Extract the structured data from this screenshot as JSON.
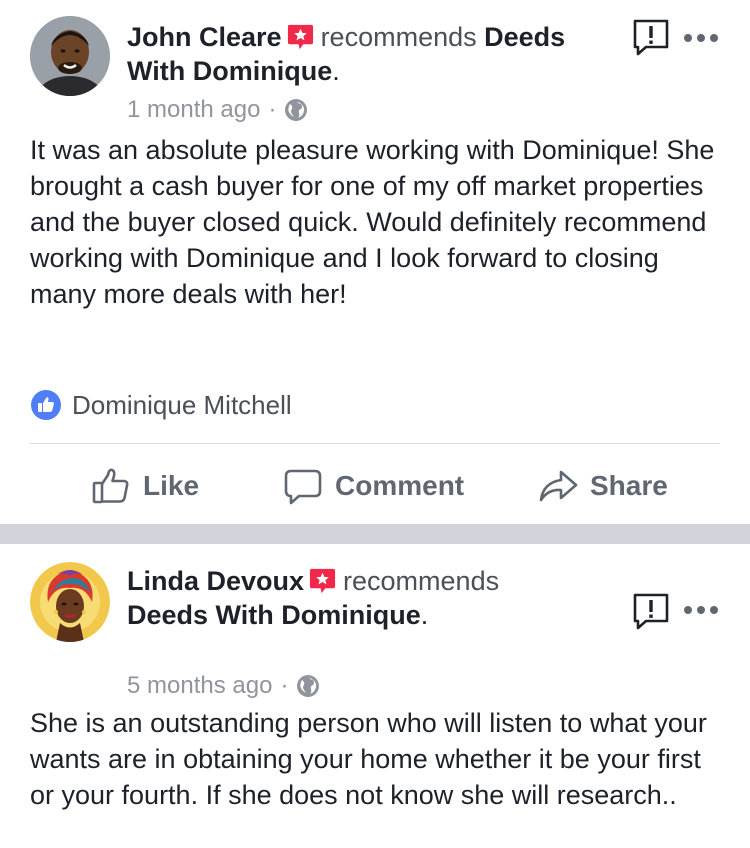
{
  "posts": [
    {
      "author": "John Cleare",
      "verb": "recommends",
      "page": "Deeds With Dominique",
      "page_line1": "Deeds",
      "page_line2": "With Dominique",
      "period": ".",
      "time": "1 month ago",
      "separator": "·",
      "body": "It was an absolute pleasure working with Dominique! She brought a cash buyer for one of my off market properties and the buyer closed quick. Would definitely recommend working with Dominique and I look forward to closing many more deals with her!",
      "liked_by": "Dominique Mitchell",
      "actions": {
        "like": "Like",
        "comment": "Comment",
        "share": "Share"
      },
      "avatar_icon": "person-avatar-man"
    },
    {
      "author": "Linda Devoux",
      "verb": "recommends",
      "page": "Deeds With Dominique",
      "period": ".",
      "time": "5 months ago",
      "separator": "·",
      "body": "She is an outstanding person who will listen to what your wants are in obtaining your home whether it be your first or your fourth. If she does not know she will research..",
      "avatar_icon": "illustrated-woman-avatar"
    }
  ],
  "colors": {
    "recommend_red": "#f0284a",
    "like_blue": "#4267b2",
    "muted_text": "#90949c",
    "action_text": "#606770",
    "separator_band": "#d1d5db"
  },
  "icons": {
    "recommend": "recommend-star-icon",
    "report": "report-exclamation-icon",
    "more": "more-dots-icon",
    "privacy": "globe-icon",
    "like_badge": "thumbs-up-badge-icon",
    "like": "thumbs-up-icon",
    "comment": "comment-bubble-icon",
    "share": "share-arrow-icon"
  }
}
